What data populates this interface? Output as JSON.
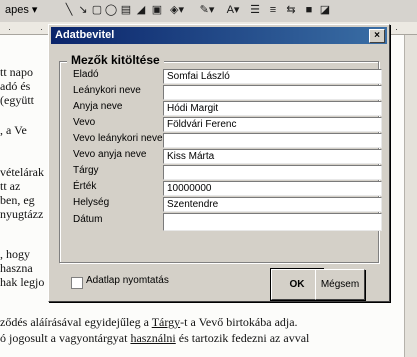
{
  "toolbar": {
    "shapes_label": "apes",
    "icons": [
      "line-tool-icon",
      "arrow-tool-icon",
      "rectangle-tool-icon",
      "oval-tool-icon",
      "textbox-icon",
      "wordart-icon",
      "clipart-icon",
      "fill-color-icon",
      "line-color-icon",
      "font-color-icon",
      "line-style-icon",
      "dash-style-icon",
      "arrow-style-icon",
      "shadow-icon",
      "3d-icon"
    ]
  },
  "document": {
    "lines": [
      "tt napo",
      "adó és",
      "(együtt",
      "",
      ", a Ve",
      "",
      "",
      "vételárak",
      "tt az",
      "ben, eg",
      "nyugtázz",
      "",
      ", hogy",
      "haszna",
      "hak legjo"
    ],
    "bottom_line_1_a": "ződés aláírásával egyidejűleg a ",
    "bottom_line_1_u": "Tárgy",
    "bottom_line_1_b": "-t a Vevő birtokába adja.",
    "bottom_line_2_a": "ó jogosult a vagyontárgyat ",
    "bottom_line_2_u": "használni",
    "bottom_line_2_b": " és tartozik fedezni az avval"
  },
  "dialog": {
    "title": "Adatbevitel",
    "close_label": "×",
    "group_title": "Mezők kitöltése",
    "fields": [
      {
        "label": "Eladó",
        "value": "Somfai László"
      },
      {
        "label": "Leánykori neve",
        "value": ""
      },
      {
        "label": "Anyja neve",
        "value": "Hódi Margit"
      },
      {
        "label": "Vevo",
        "value": "Földvári Ferenc"
      },
      {
        "label": "Vevo leánykori neve",
        "value": ""
      },
      {
        "label": "Vevo anyja neve",
        "value": "Kiss Márta"
      },
      {
        "label": "Tárgy",
        "value": ""
      },
      {
        "label": "Érték",
        "value": "10000000"
      },
      {
        "label": "Helység",
        "value": "Szentendre"
      },
      {
        "label": "Dátum",
        "value": ""
      }
    ],
    "print_checkbox_label": "Adatlap nyomtatás",
    "print_checked": false,
    "ok_label": "OK",
    "cancel_label": "Mégsem"
  }
}
